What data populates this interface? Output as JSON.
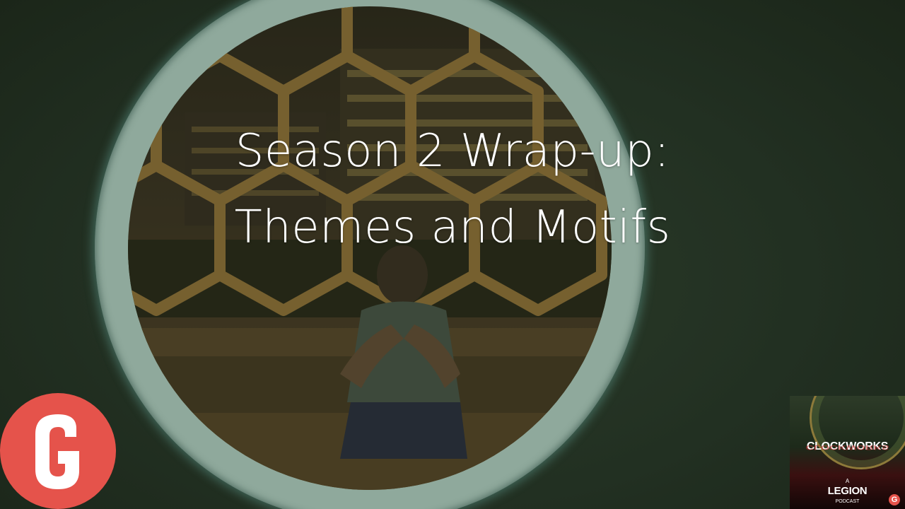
{
  "slide": {
    "title_line1": "Season 2 Wrap-up:",
    "title_line2": "Themes and Motifs"
  },
  "logos": {
    "g_logo_letter": "G",
    "podcast_art": {
      "brand": "CLOCKWORKS",
      "a_label": "A",
      "legion": "LEGION",
      "podcast_label": "PODCAST",
      "badge_letter": "G"
    }
  },
  "colors": {
    "background": "#1e2b1d",
    "ring": "#8fa99c",
    "g_logo": "#e5534b",
    "title_text": "#ffffff"
  }
}
